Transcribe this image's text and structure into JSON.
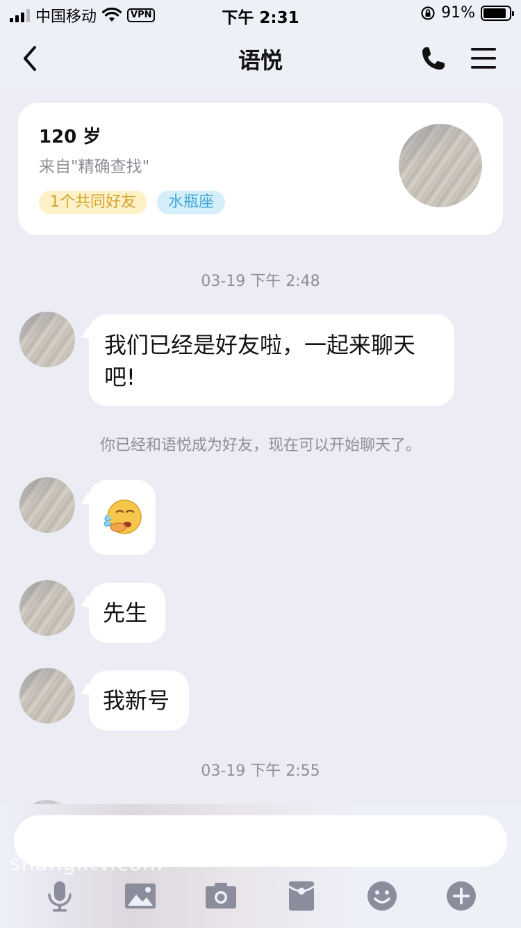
{
  "status_bar": {
    "carrier": "中国移动",
    "vpn": "VPN",
    "time": "下午 2:31",
    "battery_percent": "91%"
  },
  "nav": {
    "title": "语悦"
  },
  "profile_card": {
    "age": "120 岁",
    "source": "来自\"精确查找\"",
    "tags": [
      "1个共同好友",
      "水瓶座"
    ]
  },
  "messages": {
    "timestamp_1": "03-19 下午 2:48",
    "msg_1": "我们已经是好友啦，一起来聊天吧!",
    "system_1": "你已经和语悦成为好友，现在可以开始聊天了。",
    "msg_3": "先生",
    "msg_4": "我新号",
    "timestamp_2": "03-19 下午 2:55"
  },
  "input": {
    "watermark": "shangktv.com",
    "placeholder": ""
  },
  "toolbar": {
    "icons": [
      "microphone-icon",
      "image-icon",
      "camera-icon",
      "red-packet-icon",
      "emoji-icon",
      "plus-icon"
    ]
  },
  "colors": {
    "background": "#ececf4",
    "tag_friends_bg": "#fdf1c8",
    "tag_friends_text": "#d6a229",
    "tag_zodiac_bg": "#d4eefa",
    "tag_zodiac_text": "#3fa7d8",
    "icon_gray": "#8b8d9c"
  }
}
